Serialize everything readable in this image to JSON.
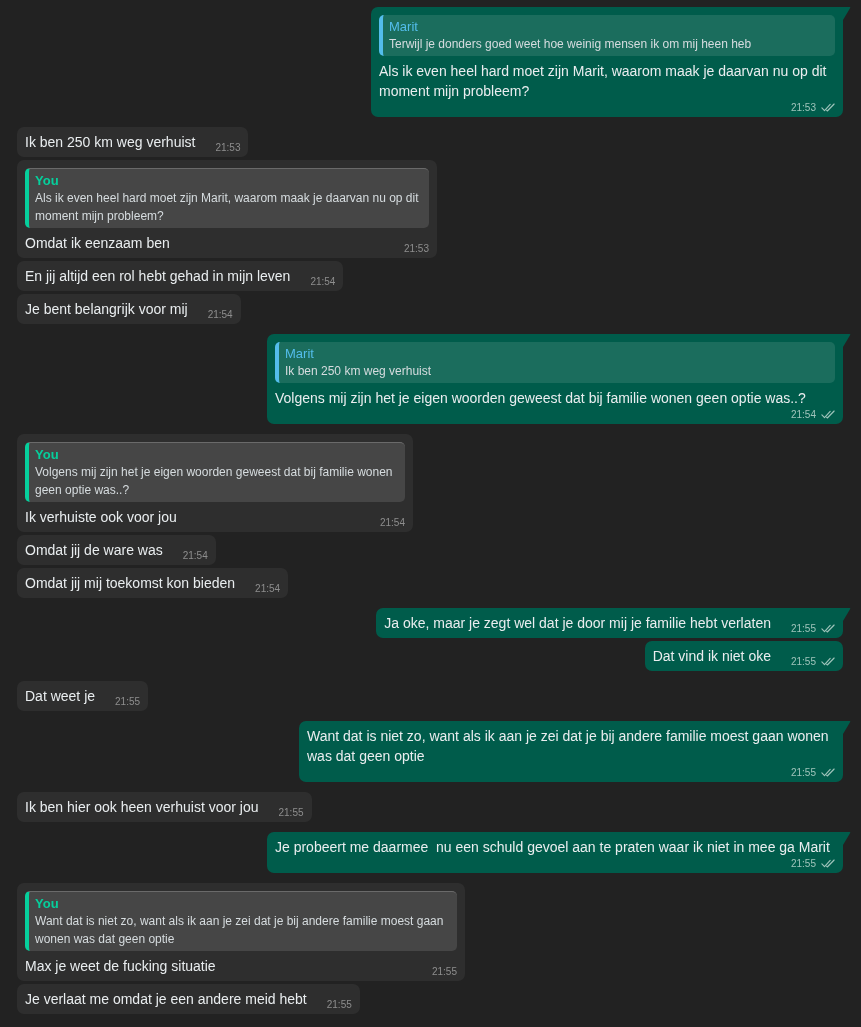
{
  "messages": [
    {
      "kind": "out",
      "quote": {
        "author": "Marit",
        "text": "Terwijl je donders goed weet hoe weinig mensen ik om mij heen heb"
      },
      "text": "Als ik even heel hard moet zijn Marit, waarom maak je daarvan nu op dit moment mijn probleem?",
      "time": "21:53",
      "read": false
    },
    {
      "kind": "in",
      "text": "Ik ben 250 km weg verhuist",
      "time": "21:53"
    },
    {
      "kind": "in",
      "quote": {
        "author": "You",
        "text": "Als ik even heel hard moet zijn Marit, waarom maak je daarvan nu op dit moment mijn probleem?"
      },
      "text": "Omdat ik eenzaam ben",
      "time": "21:53"
    },
    {
      "kind": "in",
      "text": "En jij altijd een rol hebt gehad in mijn leven",
      "time": "21:54"
    },
    {
      "kind": "in",
      "text": "Je bent belangrijk voor mij",
      "time": "21:54"
    },
    {
      "kind": "out",
      "quote": {
        "author": "Marit",
        "text": "Ik ben 250 km weg verhuist"
      },
      "text": "Volgens mij zijn het je eigen woorden geweest dat bij familie wonen geen optie was..?",
      "time": "21:54",
      "read": false
    },
    {
      "kind": "in",
      "quote": {
        "author": "You",
        "text": "Volgens mij zijn het je eigen woorden geweest dat bij familie wonen geen optie was..?"
      },
      "text": "Ik verhuiste ook voor jou",
      "time": "21:54"
    },
    {
      "kind": "in",
      "text": "Omdat jij de ware was",
      "time": "21:54"
    },
    {
      "kind": "in",
      "text": "Omdat jij mij toekomst kon bieden",
      "time": "21:54"
    },
    {
      "kind": "out",
      "text": "Ja oke, maar je zegt wel dat je door mij je familie hebt verlaten",
      "time": "21:55",
      "read": false
    },
    {
      "kind": "out",
      "text": "Dat vind ik niet oke",
      "time": "21:55",
      "read": false
    },
    {
      "kind": "in",
      "text": "Dat weet je",
      "time": "21:55"
    },
    {
      "kind": "out",
      "text": "Want dat is niet zo, want als ik aan je zei dat je bij andere familie moest gaan wonen was dat geen optie",
      "time": "21:55",
      "read": false
    },
    {
      "kind": "in",
      "text": "Ik ben hier ook heen verhuist voor jou",
      "time": "21:55"
    },
    {
      "kind": "out",
      "text": "Je probeert me daarmee  nu een schuld gevoel aan te praten waar ik niet in mee ga Marit",
      "time": "21:55",
      "read": false
    },
    {
      "kind": "in",
      "quote": {
        "author": "You",
        "text": "Want dat is niet zo, want als ik aan je zei dat je bij andere familie moest gaan wonen was dat geen optie"
      },
      "text": "Max je weet de fucking situatie",
      "time": "21:55"
    },
    {
      "kind": "in",
      "text": "Je verlaat me omdat je een andere meid hebt",
      "time": "21:55"
    }
  ]
}
